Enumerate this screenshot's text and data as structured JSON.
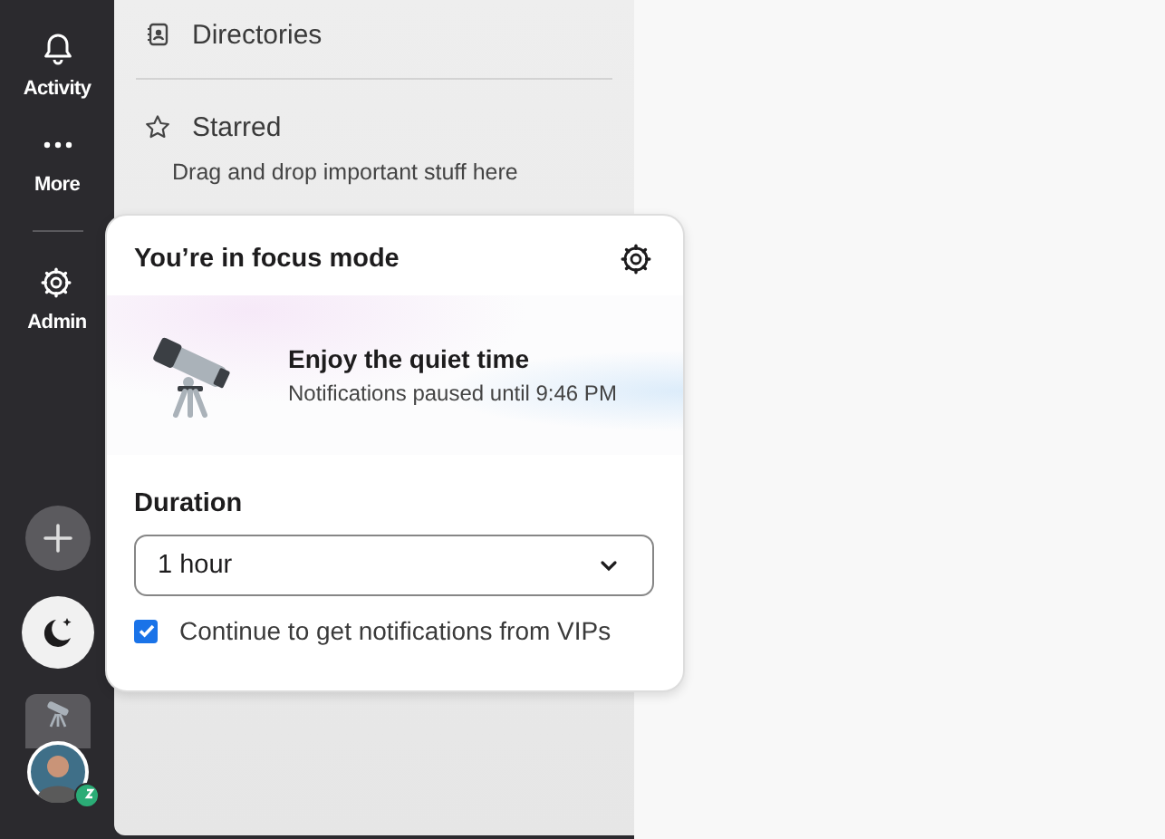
{
  "rail": {
    "items": [
      {
        "label": "Activity"
      },
      {
        "label": "More"
      },
      {
        "label": "Admin"
      }
    ]
  },
  "sidebar": {
    "directories": "Directories",
    "starred": {
      "label": "Starred",
      "hint": "Drag and drop important stuff here"
    }
  },
  "focus_popover": {
    "title": "You’re in focus mode",
    "banner": {
      "heading": "Enjoy the quiet time",
      "subtext": "Notifications paused until 9:46 PM"
    },
    "duration": {
      "label": "Duration",
      "value": "1 hour"
    },
    "vip_option": {
      "label": "Continue to get notifications from VIPs",
      "checked": true
    }
  }
}
